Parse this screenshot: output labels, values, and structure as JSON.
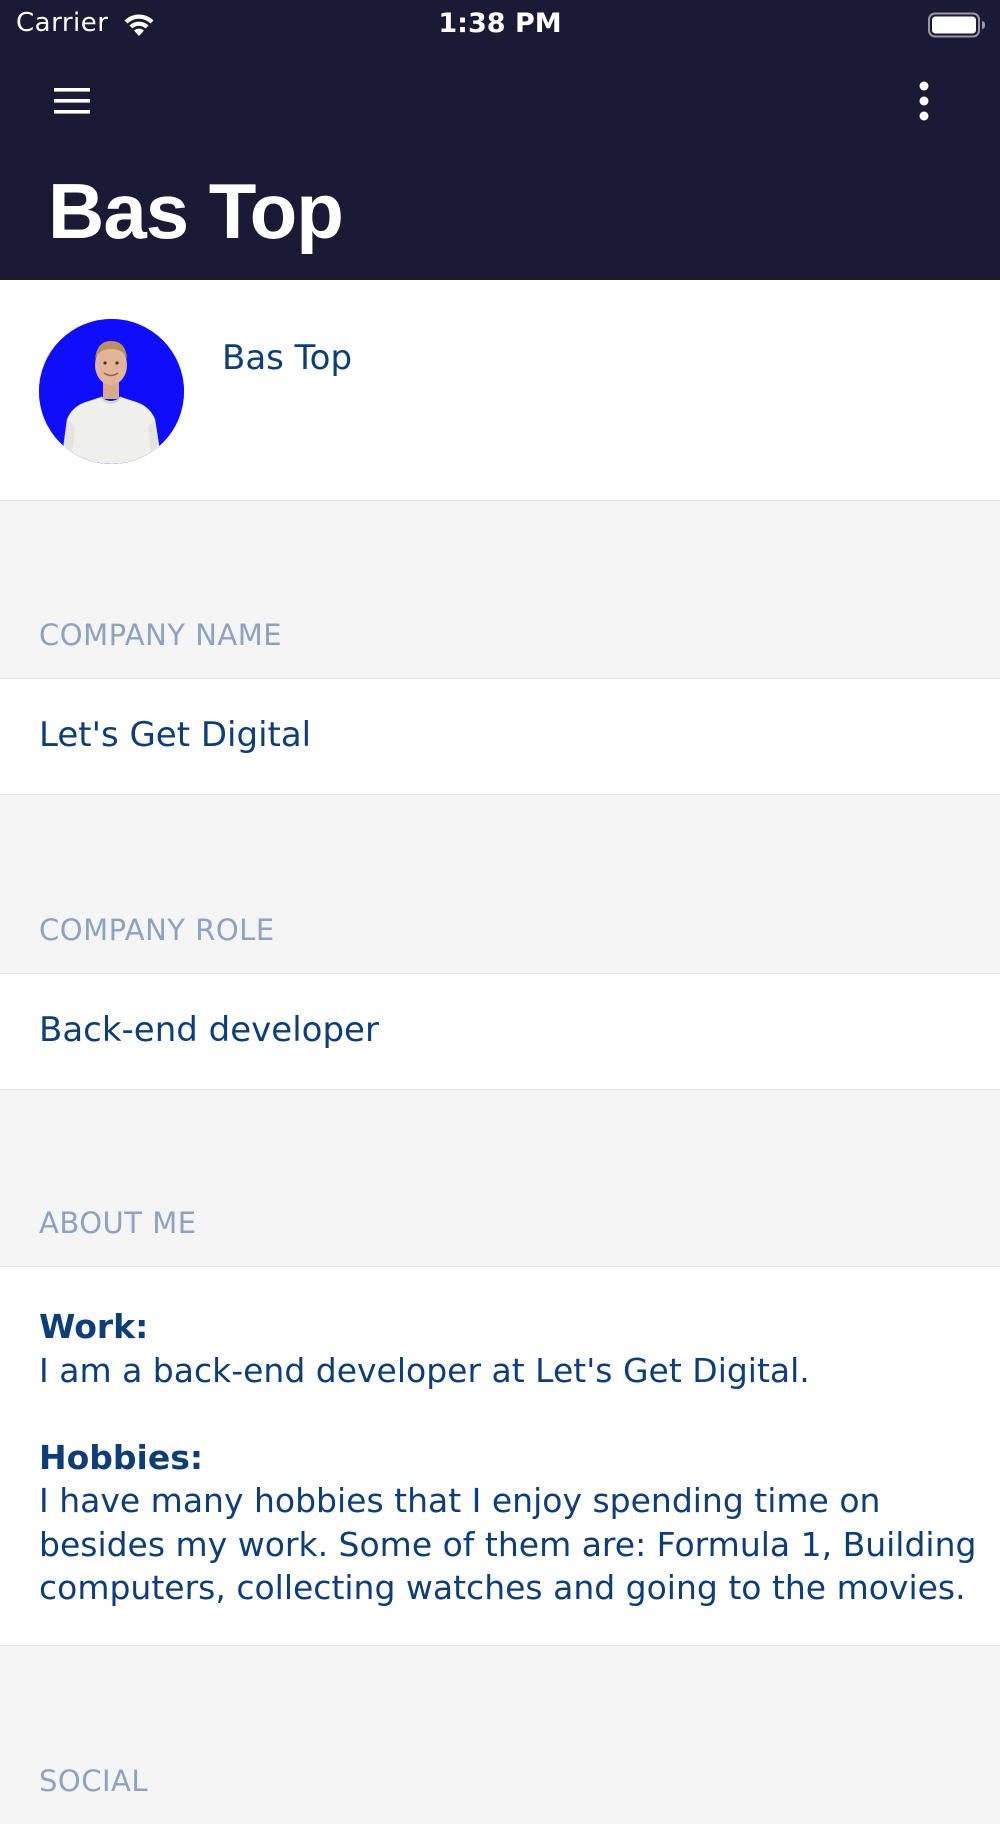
{
  "status_bar": {
    "carrier": "Carrier",
    "time": "1:38 PM",
    "icons": [
      "wifi-icon",
      "battery-icon"
    ]
  },
  "header": {
    "title": "Bas Top",
    "background_color": "#1b1a35",
    "left_icon": "menu-icon",
    "right_icon": "more-vertical-icon"
  },
  "profile": {
    "name": "Bas Top",
    "avatar_background": "#0f0dfb"
  },
  "sections": {
    "company_name": {
      "label": "COMPANY NAME",
      "value": "Let's Get Digital"
    },
    "company_role": {
      "label": "COMPANY ROLE",
      "value": "Back-end developer"
    },
    "about_me": {
      "label": "ABOUT ME",
      "work_heading": "Work:",
      "work_text": "I am a back-end developer at Let's Get Digital.",
      "hobbies_heading": "Hobbies:",
      "hobbies_text": "I have many hobbies that I enjoy spending time on besides my work. Some of them are: Formula 1, Building computers, collecting watches and going to the movies."
    },
    "social": {
      "label": "SOCIAL"
    }
  },
  "colors": {
    "text_primary": "#0e3d79",
    "section_label": "#8ea3be",
    "background": "#f5f5f6"
  }
}
